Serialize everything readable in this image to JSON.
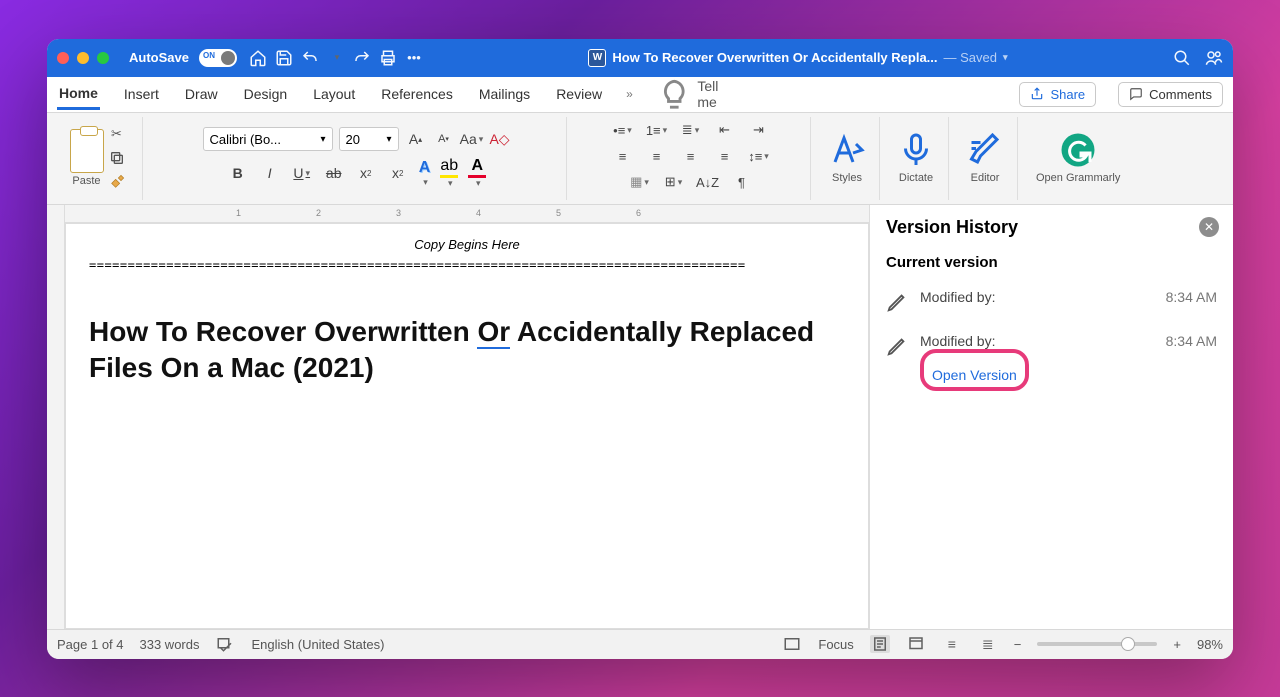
{
  "titlebar": {
    "autosave_label": "AutoSave",
    "autosave_state": "ON",
    "doc_title": "How To Recover Overwritten Or Accidentally Repla...",
    "saved_state": "— Saved"
  },
  "ribbon_tabs": {
    "home": "Home",
    "insert": "Insert",
    "draw": "Draw",
    "design": "Design",
    "layout": "Layout",
    "references": "References",
    "mailings": "Mailings",
    "review": "Review",
    "tell_me": "Tell me",
    "share": "Share",
    "comments": "Comments"
  },
  "ribbon": {
    "paste": "Paste",
    "font_name": "Calibri (Bo...",
    "font_size": "20",
    "styles": "Styles",
    "dictate": "Dictate",
    "editor": "Editor",
    "open_grammarly": "Open Grammarly"
  },
  "ruler": {
    "marks": [
      "1",
      "2",
      "3",
      "4",
      "5",
      "6"
    ]
  },
  "document": {
    "copy_begins": "Copy Begins Here",
    "separator": "=====================================================================================",
    "h1_a": "How To Recover Overwritten ",
    "h1_or": "Or",
    "h1_b": " Accidentally Replaced Files On a Mac (2021)"
  },
  "version_pane": {
    "title": "Version History",
    "current": "Current version",
    "modified_by": "Modified by:",
    "time1": "8:34 AM",
    "time2": "8:34 AM",
    "open_version": "Open Version"
  },
  "status": {
    "page": "Page 1 of 4",
    "words": "333 words",
    "lang": "English (United States)",
    "focus": "Focus",
    "zoom": "98%"
  }
}
